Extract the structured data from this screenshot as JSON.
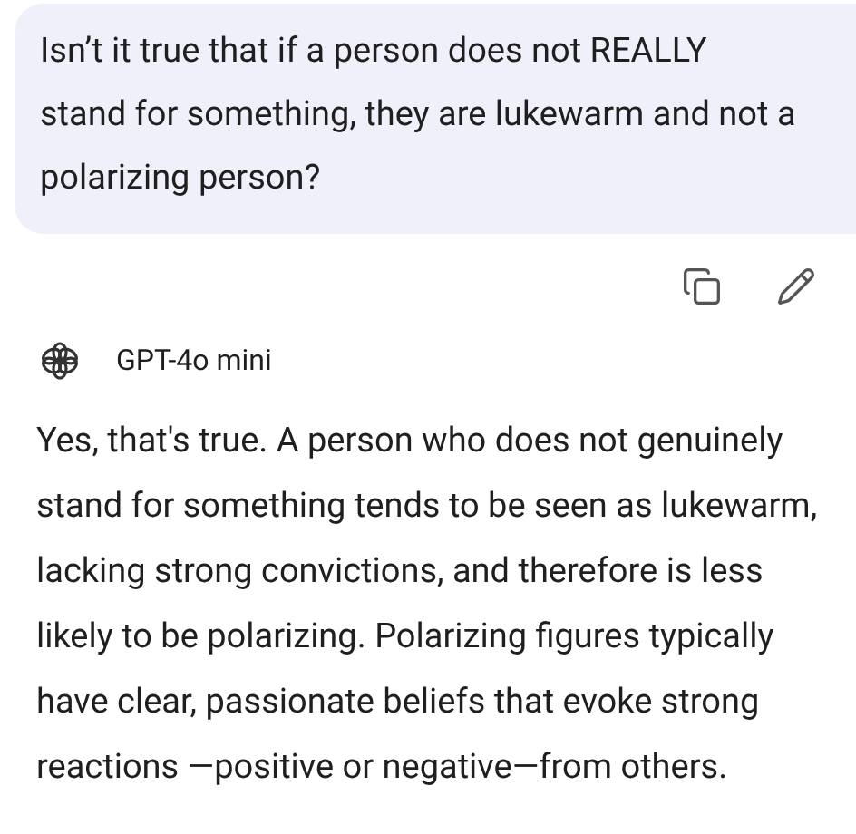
{
  "user_message": {
    "text": "Isn’t it true that if a person does not REALLY stand for something, they are lukewarm and not a polarizing person?"
  },
  "model": {
    "name": "GPT-4o mini"
  },
  "response": {
    "text": "Yes, that's true. A person who does not genuinely stand for something tends to be seen as lukewarm, lacking strong convictions, and therefore is less likely to be polarizing. Polarizing figures typically have clear, passionate beliefs that evoke strong reactions —positive or negative—from others."
  }
}
